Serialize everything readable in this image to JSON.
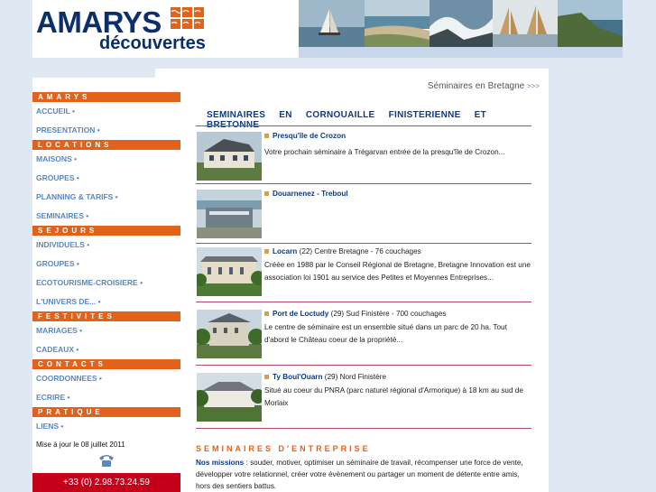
{
  "header": {
    "logo_line1": "AMARYS",
    "logo_line2": "découvertes"
  },
  "breadcrumb": {
    "label": "Séminaires en Bretagne",
    "arrows": ">>>"
  },
  "sidebar": {
    "sections": [
      {
        "heading": "AMARYS",
        "items": [
          "ACCUEIL •",
          "PRESENTATION •"
        ]
      },
      {
        "heading": "LOCATIONS",
        "items": [
          "MAISONS •",
          "GROUPES •",
          "PLANNING & TARIFS •",
          "SEMINAIRES •"
        ]
      },
      {
        "heading": "SEJOURS",
        "items": [
          "INDIVIDUELS •",
          "GROUPES •",
          "ECOTOURISME-CROISIERE •",
          "L'UNIVERS DE... •"
        ]
      },
      {
        "heading": "FESTIVITES",
        "items": [
          "MARIAGES •",
          "CADEAUX •"
        ]
      },
      {
        "heading": "CONTACTS",
        "items": [
          "COORDONNEES •",
          "ECRIRE •"
        ]
      },
      {
        "heading": "PRATIQUE",
        "items": [
          "LIENS •"
        ]
      }
    ],
    "update_text": "Mise à jour le 08 juillet 2011",
    "phone": "+33 (0) 2.98.73.24.59"
  },
  "main": {
    "title": "SEMINAIRES EN CORNOUAILLE FINISTERIENNE ET BRETONNE",
    "cards": [
      {
        "title": "Presqu'île de Crozon",
        "sub": "",
        "text": "Votre prochain séminaire à Trégarvan entrée de la presqu'île de Crozon..."
      },
      {
        "title": "Douarnenez - Treboul",
        "sub": "",
        "text": ""
      },
      {
        "title": "Locarn",
        "sub": " (22) Centre Bretagne - 76 couchages",
        "text": "Créée en 1988 par le Conseil Régional de Bretagne, Bretagne Innovation est une association loi 1901 au service des Petites et Moyennes Entreprises..."
      },
      {
        "title": "Port de Loctudy",
        "sub": " (29) Sud Finistère - 700 couchages",
        "text": " Le centre de séminaire est un ensemble situé dans un parc de 20 ha. Tout d'abord le Château coeur de la propriété..."
      },
      {
        "title": "Ty Boul'Ouarn",
        "sub": " (29) Nord Finistère",
        "text": "Situé au coeur du PNRA (parc naturel régional d'Armorique) à 18 km au sud de Morlaix"
      }
    ],
    "section_title": "SEMINAIRES D'ENTREPRISE",
    "missions_label": "Nos missions",
    "missions_text": " : souder, motiver, optimiser un séminaire de travail, récompenser une force de vente, développer votre relationnel, créer votre évènement ou partager un moment de détente entre amis, hors des sentiers battus."
  },
  "colors": {
    "accent": "#e2621b",
    "brand": "#0b2f6b",
    "link": "#5b87be",
    "phone_bg": "#c4001a"
  },
  "icons": {
    "phone": "telephone-icon",
    "bullet": "square-bullet-icon"
  }
}
